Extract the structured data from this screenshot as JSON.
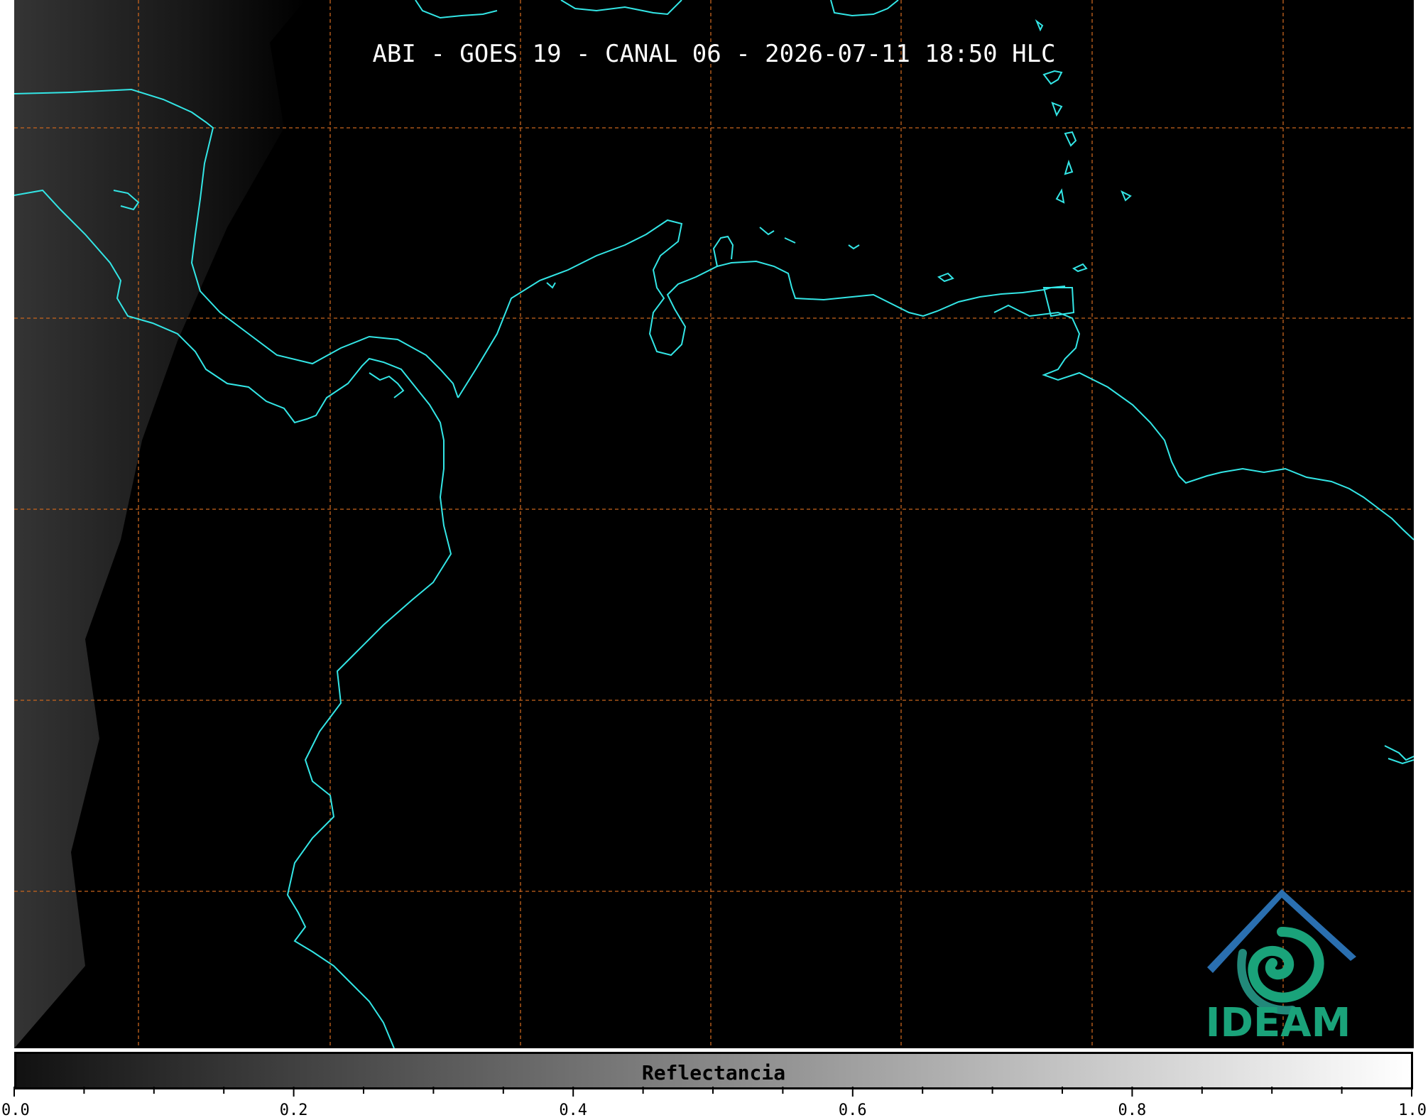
{
  "title": "ABI - GOES 19 - CANAL 06 - 2026-07-11 18:50 HLC",
  "logo_text": "IDEAM",
  "colorbar": {
    "label": "Reflectancia",
    "range": [
      0.0,
      1.0
    ],
    "gradient": [
      "#111111",
      "#ffffff"
    ],
    "major_ticks": [
      "0.0",
      "0.2",
      "0.4",
      "0.6",
      "0.8",
      "1.0"
    ],
    "minor_tick_step": 0.05
  },
  "colors": {
    "background": "#000000",
    "coastline": "#33e6e6",
    "gridline": "#c8651e",
    "logo_blue": "#2a6fb0",
    "logo_green": "#1aa37a"
  },
  "grid": {
    "style": "dashed",
    "vertical_lines": 7,
    "horizontal_lines": 5
  }
}
